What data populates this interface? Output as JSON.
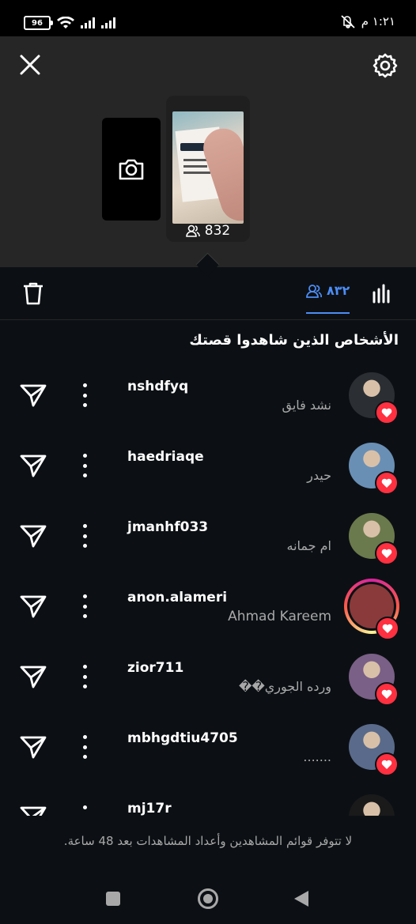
{
  "status_bar": {
    "time": "١:٢١ م",
    "battery": "96"
  },
  "story": {
    "view_count": "832"
  },
  "toolbar": {
    "viewers_count": "٨٣٢"
  },
  "heading": "الأشخاص الذين شاهدوا قصتك",
  "viewers": [
    {
      "username": "nshdfyq",
      "full_name": "نشد فايق",
      "avatar_color": "#2b2f33",
      "has_story_ring": false
    },
    {
      "username": "haedriaqe",
      "full_name": "حيدر",
      "avatar_color": "#6a8fb5",
      "has_story_ring": false
    },
    {
      "username": "jmanhf033",
      "full_name": "ام جمانه",
      "avatar_color": "#6b7a4c",
      "has_story_ring": false
    },
    {
      "username": "anon.alameri",
      "full_name": "Ahmad Kareem",
      "avatar_color": "#8a3a3a",
      "has_story_ring": true
    },
    {
      "username": "zior711",
      "full_name": "ورده الجوري��",
      "avatar_color": "#7a5f86",
      "has_story_ring": false
    },
    {
      "username": "mbhgdtiu4705",
      "full_name": ".......",
      "avatar_color": "#5a6a8a",
      "has_story_ring": false
    },
    {
      "username": "mj17r",
      "full_name": "",
      "avatar_color": "#1a1a1a",
      "has_story_ring": false
    }
  ],
  "footer_note": "لا تتوفر قوائم المشاهدين وأعداد المشاهدات بعد 48 ساعة.",
  "colors": {
    "accent": "#4c8df6",
    "like": "#ff3040",
    "background": "#0c1014"
  }
}
